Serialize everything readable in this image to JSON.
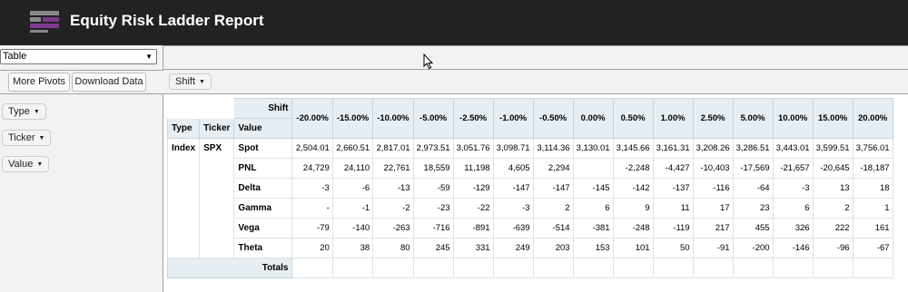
{
  "header": {
    "title": "Equity Risk Ladder Report"
  },
  "colors": {
    "header_bg": "#222222",
    "logo_purple": "#7d3a8c",
    "logo_gray": "#888888",
    "table_header_bg": "#e6eef3"
  },
  "renderer_select": {
    "value": "Table"
  },
  "buttons": {
    "more_pivots": "More Pivots",
    "download_data": "Download Data"
  },
  "col_attr": {
    "label": "Shift"
  },
  "row_attrs": [
    {
      "label": "Type"
    },
    {
      "label": "Ticker"
    },
    {
      "label": "Value"
    }
  ],
  "table": {
    "col_axis_label": "Shift",
    "row_headers": [
      "Type",
      "Ticker",
      "Value"
    ],
    "columns": [
      "-20.00%",
      "-15.00%",
      "-10.00%",
      "-5.00%",
      "-2.50%",
      "-1.00%",
      "-0.50%",
      "0.00%",
      "0.50%",
      "1.00%",
      "2.50%",
      "5.00%",
      "10.00%",
      "15.00%",
      "20.00%"
    ],
    "type_value": "Index",
    "ticker_value": "SPX",
    "rows": [
      {
        "label": "Spot",
        "values": [
          "2,504.01",
          "2,660.51",
          "2,817.01",
          "2,973.51",
          "3,051.76",
          "3,098.71",
          "3,114.36",
          "3,130.01",
          "3,145.66",
          "3,161.31",
          "3,208.26",
          "3,286.51",
          "3,443.01",
          "3,599.51",
          "3,756.01"
        ]
      },
      {
        "label": "PNL",
        "values": [
          "24,729",
          "24,110",
          "22,761",
          "18,559",
          "11,198",
          "4,605",
          "2,294",
          "",
          "-2,248",
          "-4,427",
          "-10,403",
          "-17,569",
          "-21,657",
          "-20,645",
          "-18,187"
        ]
      },
      {
        "label": "Delta",
        "values": [
          "-3",
          "-6",
          "-13",
          "-59",
          "-129",
          "-147",
          "-147",
          "-145",
          "-142",
          "-137",
          "-116",
          "-64",
          "-3",
          "13",
          "18"
        ]
      },
      {
        "label": "Gamma",
        "values": [
          "-",
          "-1",
          "-2",
          "-23",
          "-22",
          "-3",
          "2",
          "6",
          "9",
          "11",
          "17",
          "23",
          "6",
          "2",
          "1"
        ]
      },
      {
        "label": "Vega",
        "values": [
          "-79",
          "-140",
          "-263",
          "-716",
          "-891",
          "-639",
          "-514",
          "-381",
          "-248",
          "-119",
          "217",
          "455",
          "326",
          "222",
          "161"
        ]
      },
      {
        "label": "Theta",
        "values": [
          "20",
          "38",
          "80",
          "245",
          "331",
          "249",
          "203",
          "153",
          "101",
          "50",
          "-91",
          "-200",
          "-146",
          "-96",
          "-67"
        ]
      }
    ],
    "totals_label": "Totals"
  }
}
